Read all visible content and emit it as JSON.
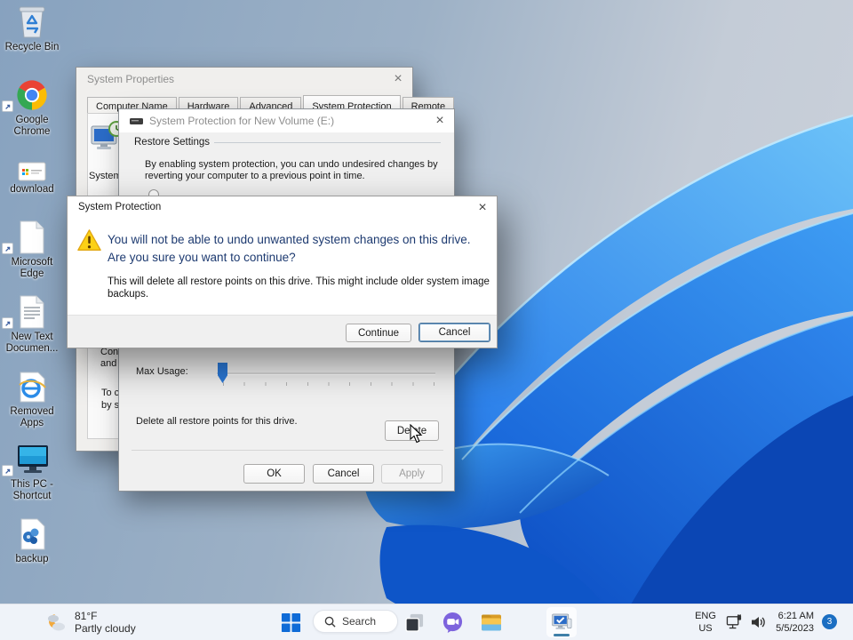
{
  "desktop": {
    "icons": [
      {
        "label": "Recycle Bin",
        "icon": "recycle-bin-icon"
      },
      {
        "label": "Google Chrome",
        "icon": "chrome-icon"
      },
      {
        "label": "download",
        "icon": "download-file-icon"
      },
      {
        "label": "Microsoft Edge",
        "icon": "edge-shortcut-icon"
      },
      {
        "label": "New Text Documen...",
        "icon": "text-document-icon"
      },
      {
        "label": "Removed Apps",
        "icon": "removed-apps-icon"
      },
      {
        "label": "This PC - Shortcut",
        "icon": "this-pc-icon"
      },
      {
        "label": "backup",
        "icon": "backup-file-icon"
      }
    ]
  },
  "system_properties": {
    "title": "System Properties",
    "tabs": [
      "Computer Name",
      "Hardware",
      "Advanced",
      "System Protection",
      "Remote"
    ],
    "active_tab": "System Protection",
    "icon_caption": "System",
    "fragments": [
      "Confi",
      "and d",
      "To cr",
      "by se"
    ]
  },
  "volume_dialog": {
    "title": "System Protection for New Volume (E:)",
    "restore_group": "Restore Settings",
    "restore_text_line1": "By enabling system protection, you can undo undesired changes by",
    "restore_text_line2": "reverting your computer to a previous point in time.",
    "max_usage_label": "Max Usage:",
    "delete_text": "Delete all restore points for this drive.",
    "buttons": {
      "delete": "Delete",
      "ok": "OK",
      "cancel": "Cancel",
      "apply": "Apply"
    }
  },
  "warning_dialog": {
    "title": "System Protection",
    "main_text": "You will not be able to undo unwanted system changes on this drive. Are you sure you want to continue?",
    "detail_line1": "This will delete all restore points on this drive. This might include older system image",
    "detail_line2": "backups.",
    "buttons": {
      "continue": "Continue",
      "cancel": "Cancel"
    }
  },
  "taskbar": {
    "weather": {
      "temp": "81°F",
      "condition": "Partly cloudy"
    },
    "search_placeholder": "Search",
    "tray": {
      "lang_line1": "ENG",
      "lang_line2": "US",
      "time": "6:21 AM",
      "date": "5/5/2023",
      "notification_count": "3"
    }
  },
  "colors": {
    "accent": "#0f6bd7",
    "main_instruction_text": "#1d3a70",
    "badge": "#1b6ec2",
    "warning_yellow": "#fcd116"
  }
}
